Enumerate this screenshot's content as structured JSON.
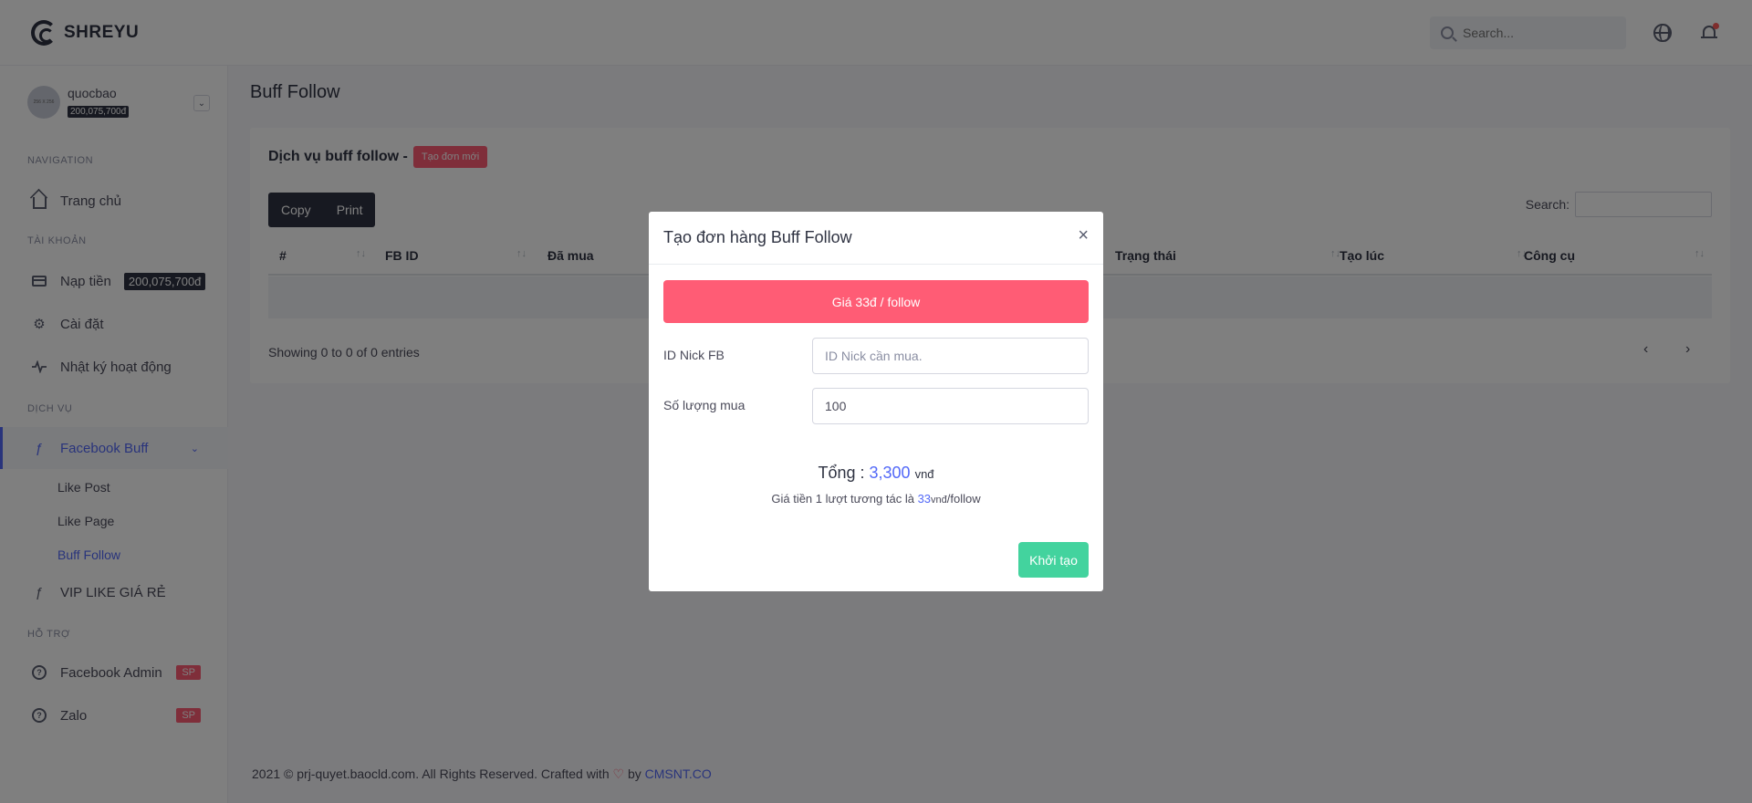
{
  "topbar": {
    "brand": "SHREYU",
    "search_placeholder": "Search..."
  },
  "user": {
    "avatar_text": "256 X 256",
    "name": "quocbao",
    "balance": "200,075,700đ"
  },
  "nav": {
    "heading_navigation": "NAVIGATION",
    "home": "Trang chủ",
    "heading_account": "TÀI KHOẢN",
    "topup": "Nạp tiền",
    "topup_badge": "200,075,700đ",
    "settings": "Cài đặt",
    "activity_log": "Nhật ký hoạt động",
    "heading_services": "DỊCH VỤ",
    "facebook_buff": "Facebook Buff",
    "sub_like_post": "Like Post",
    "sub_like_page": "Like Page",
    "sub_buff_follow": "Buff Follow",
    "vip_like": "VIP LIKE GIÁ RẺ",
    "heading_support": "HỖ TRỢ",
    "facebook_admin": "Facebook Admin",
    "zalo": "Zalo",
    "sp_badge": "SP"
  },
  "page": {
    "title": "Buff Follow",
    "card_title": "Dịch vụ buff follow -",
    "new_order_button": "Tạo đơn mới",
    "copy_button": "Copy",
    "print_button": "Print",
    "search_label": "Search:",
    "columns": [
      "#",
      "FB ID",
      "Đã mua",
      "Trạng thái",
      "Tạo lúc",
      "Công cụ"
    ],
    "showing": "Showing 0 to 0 of 0 entries",
    "prev": "‹",
    "next": "›"
  },
  "footer": {
    "text": "2021 © prj-quyet.baocld.com. All Rights Reserved. Crafted with",
    "heart": "♡",
    "by": "by",
    "brand": "CMSNT.CO"
  },
  "modal": {
    "title": "Tạo đơn hàng Buff Follow",
    "close": "×",
    "price_label": "Giá 33đ / follow",
    "id_label": "ID Nick FB",
    "id_placeholder": "ID Nick cần mua.",
    "qty_label": "Số lượng mua",
    "qty_value": "100",
    "total_label": "Tổng :",
    "total_value": "3,300",
    "total_unit": "vnđ",
    "note_prefix": "Giá tiền 1 lượt tương tác là",
    "note_value": "33",
    "note_unit": "vnđ",
    "note_suffix": "/follow",
    "submit": "Khởi tạo"
  }
}
